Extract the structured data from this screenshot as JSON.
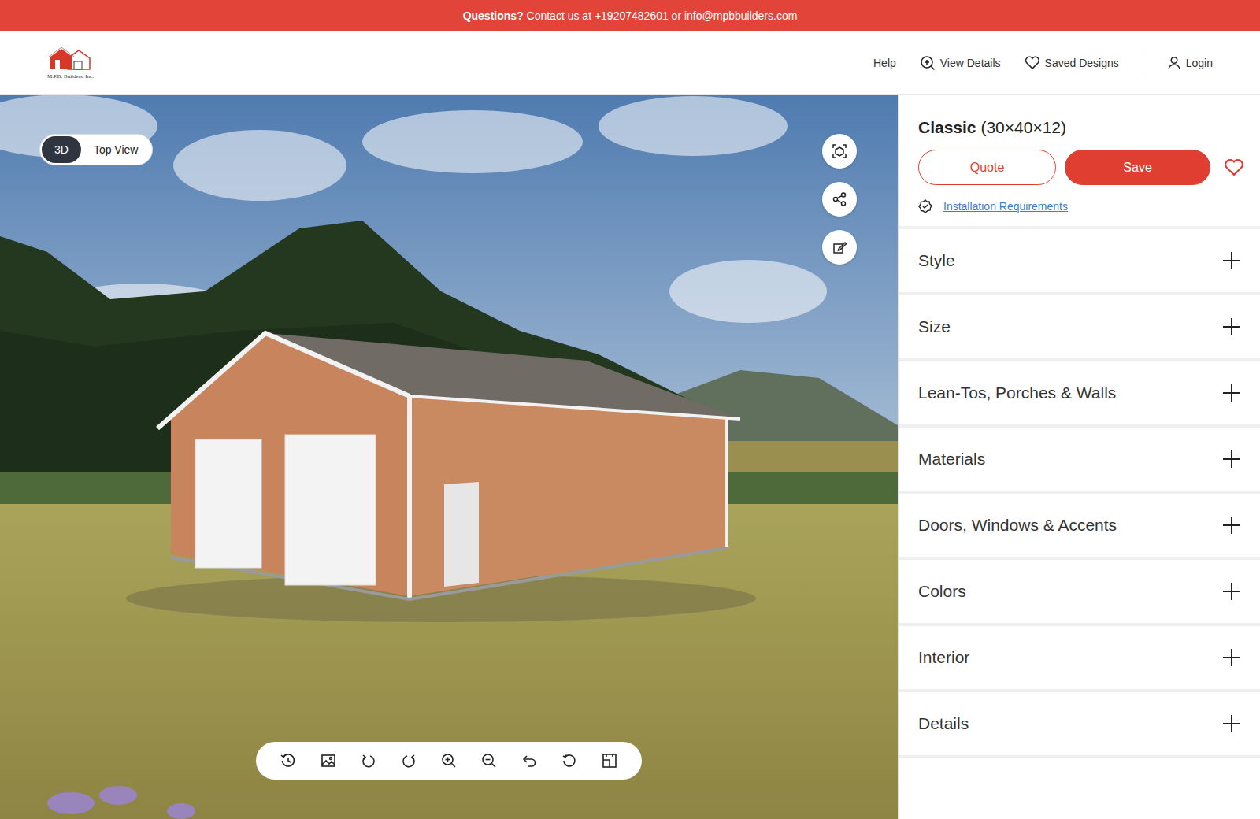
{
  "banner": {
    "label": "Questions?",
    "text": "Contact us at +19207482601 or info@mpbbuilders.com"
  },
  "logo": {
    "text": "M.P.B. Builders, Inc."
  },
  "nav": [
    {
      "label": "Help",
      "kind": "plain"
    },
    {
      "label": "View Details",
      "kind": "details"
    },
    {
      "label": "Saved Designs",
      "kind": "saved"
    },
    {
      "label": "Login",
      "kind": "account"
    }
  ],
  "view_toggle": [
    {
      "label": "3D",
      "selected": true
    },
    {
      "label": "Top View",
      "selected": false
    }
  ],
  "product": {
    "name": "Classic",
    "size": "(30×40×12)"
  },
  "actions": {
    "quote": "Quote",
    "save": "Save",
    "favorited": false
  },
  "requirements_link": "Installation Requirements",
  "sections": [
    {
      "label": "Style",
      "expanded": false
    },
    {
      "label": "Size",
      "expanded": false
    },
    {
      "label": "Lean-Tos, Porches & Walls",
      "expanded": false
    },
    {
      "label": "Materials",
      "expanded": false
    },
    {
      "label": "Doors, Windows & Accents",
      "expanded": false
    },
    {
      "label": "Colors",
      "expanded": false
    },
    {
      "label": "Interior",
      "expanded": false
    },
    {
      "label": "Details",
      "expanded": false
    }
  ]
}
